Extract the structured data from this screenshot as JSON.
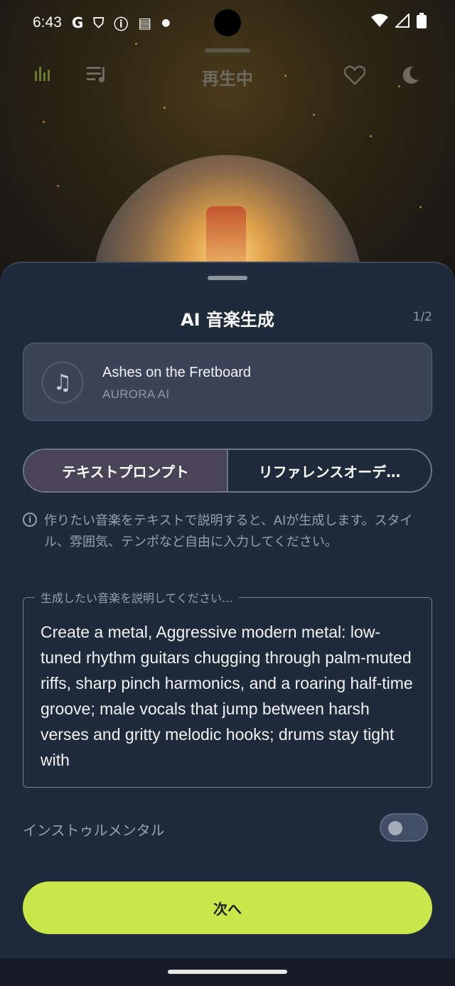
{
  "status": {
    "time": "6:43",
    "icons": [
      "google-icon",
      "shield-icon",
      "info-icon",
      "calendar-icon",
      "dot-icon"
    ],
    "right_icons": [
      "wifi-icon",
      "signal-icon",
      "battery-icon"
    ]
  },
  "player": {
    "title": "再生中",
    "icons": [
      "equalizer-icon",
      "queue-icon",
      "heart-icon",
      "moon-icon"
    ]
  },
  "sheet": {
    "title": "AI 音楽生成",
    "step": "1/2",
    "song": {
      "title": "Ashes on the Fretboard",
      "artist": "AURORA AI",
      "icon": "music-note-icon"
    },
    "tabs": [
      {
        "label": "テキストプロンプト",
        "active": true
      },
      {
        "label": "リファレンスオーデ…",
        "active": false
      }
    ],
    "info": "作りたい音楽をテキストで説明すると、AIが生成します。スタイル、雰囲気、テンポなど自由に入力してください。",
    "prompt": {
      "label": "生成したい音楽を説明してください…",
      "value": "Create a metal, Aggressive modern metal: low-tuned rhythm guitars chugging through palm-muted riffs, sharp pinch harmonics, and a roaring half-time groove; male vocals that jump between harsh verses and gritty melodic hooks; drums stay tight with"
    },
    "instrumental": {
      "label": "インストゥルメンタル",
      "on": false
    },
    "next_label": "次へ"
  },
  "colors": {
    "accent": "#c9e64a",
    "sheet_bg": "#1f2a3a",
    "card_bg": "#3a4456"
  }
}
